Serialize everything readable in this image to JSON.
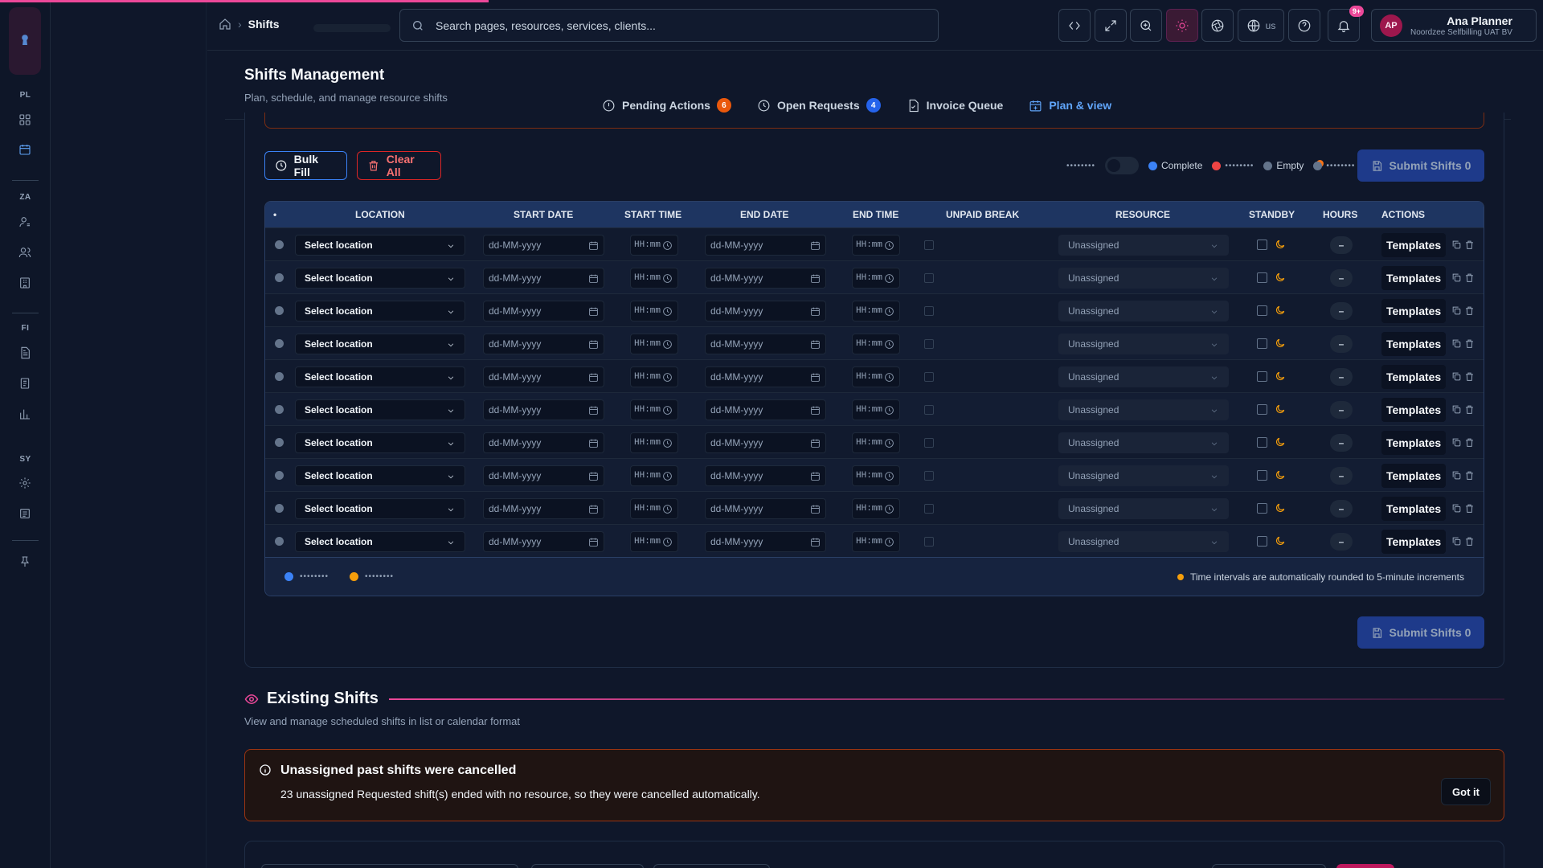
{
  "breadcrumb": {
    "current": "Shifts"
  },
  "search": {
    "placeholder": "Search pages, resources, services, clients..."
  },
  "topbar": {
    "lang": "us",
    "notif_count": "9+"
  },
  "user": {
    "initials": "AP",
    "name": "Ana Planner",
    "org": "Noordzee Selfbilling UAT BV"
  },
  "rail": {
    "sections": [
      "PL",
      "ZA",
      "FI",
      "SY"
    ]
  },
  "page": {
    "title": "Shifts Management",
    "subtitle": "Plan, schedule, and manage resource shifts"
  },
  "tabs": [
    {
      "label": "Pending Actions",
      "badge": "6",
      "badge_color": "#ea580c"
    },
    {
      "label": "Open Requests",
      "badge": "4",
      "badge_color": "#2563eb"
    },
    {
      "label": "Invoice Queue",
      "badge": ""
    },
    {
      "label": "Plan & view",
      "badge": "",
      "active": true
    }
  ],
  "toolbar": {
    "bulk_fill": "Bulk Fill",
    "clear_all": "Clear All",
    "legend_complete": "Complete",
    "legend_empty": "Empty",
    "submit": "Submit Shifts 0"
  },
  "table": {
    "columns": [
      "•",
      "LOCATION",
      "START DATE",
      "START TIME",
      "END DATE",
      "END TIME",
      "UNPAID BREAK",
      "RESOURCE",
      "STANDBY",
      "HOURS",
      "ACTIONS"
    ],
    "rows": [
      {
        "location": "Select location",
        "start_date": "dd-MM-yyyy",
        "start_time": "HH:mm",
        "end_date": "dd-MM-yyyy",
        "end_time": "HH:mm",
        "resource": "Unassigned",
        "hours": "–",
        "action": "Templates"
      },
      {
        "location": "Select location",
        "start_date": "dd-MM-yyyy",
        "start_time": "HH:mm",
        "end_date": "dd-MM-yyyy",
        "end_time": "HH:mm",
        "resource": "Unassigned",
        "hours": "–",
        "action": "Templates"
      },
      {
        "location": "Select location",
        "start_date": "dd-MM-yyyy",
        "start_time": "HH:mm",
        "end_date": "dd-MM-yyyy",
        "end_time": "HH:mm",
        "resource": "Unassigned",
        "hours": "–",
        "action": "Templates"
      },
      {
        "location": "Select location",
        "start_date": "dd-MM-yyyy",
        "start_time": "HH:mm",
        "end_date": "dd-MM-yyyy",
        "end_time": "HH:mm",
        "resource": "Unassigned",
        "hours": "–",
        "action": "Templates"
      },
      {
        "location": "Select location",
        "start_date": "dd-MM-yyyy",
        "start_time": "HH:mm",
        "end_date": "dd-MM-yyyy",
        "end_time": "HH:mm",
        "resource": "Unassigned",
        "hours": "–",
        "action": "Templates"
      },
      {
        "location": "Select location",
        "start_date": "dd-MM-yyyy",
        "start_time": "HH:mm",
        "end_date": "dd-MM-yyyy",
        "end_time": "HH:mm",
        "resource": "Unassigned",
        "hours": "–",
        "action": "Templates"
      },
      {
        "location": "Select location",
        "start_date": "dd-MM-yyyy",
        "start_time": "HH:mm",
        "end_date": "dd-MM-yyyy",
        "end_time": "HH:mm",
        "resource": "Unassigned",
        "hours": "–",
        "action": "Templates"
      },
      {
        "location": "Select location",
        "start_date": "dd-MM-yyyy",
        "start_time": "HH:mm",
        "end_date": "dd-MM-yyyy",
        "end_time": "HH:mm",
        "resource": "Unassigned",
        "hours": "–",
        "action": "Templates"
      },
      {
        "location": "Select location",
        "start_date": "dd-MM-yyyy",
        "start_time": "HH:mm",
        "end_date": "dd-MM-yyyy",
        "end_time": "HH:mm",
        "resource": "Unassigned",
        "hours": "–",
        "action": "Templates"
      },
      {
        "location": "Select location",
        "start_date": "dd-MM-yyyy",
        "start_time": "HH:mm",
        "end_date": "dd-MM-yyyy",
        "end_time": "HH:mm",
        "resource": "Unassigned",
        "hours": "–",
        "action": "Templates"
      }
    ],
    "footer_note": "Time intervals are automatically rounded to 5-minute increments"
  },
  "existing": {
    "title": "Existing Shifts",
    "subtitle": "View and manage scheduled shifts in list or calendar format",
    "notice_title": "Unassigned past shifts were cancelled",
    "notice_body": "23 unassigned Requested shift(s) ended with no resource, so they were cancelled automatically.",
    "notice_button": "Got it"
  },
  "colors": {
    "accent": "#3b82f6",
    "brand": "#ec4899",
    "danger": "#dc2626",
    "warning": "#f59e0b"
  }
}
